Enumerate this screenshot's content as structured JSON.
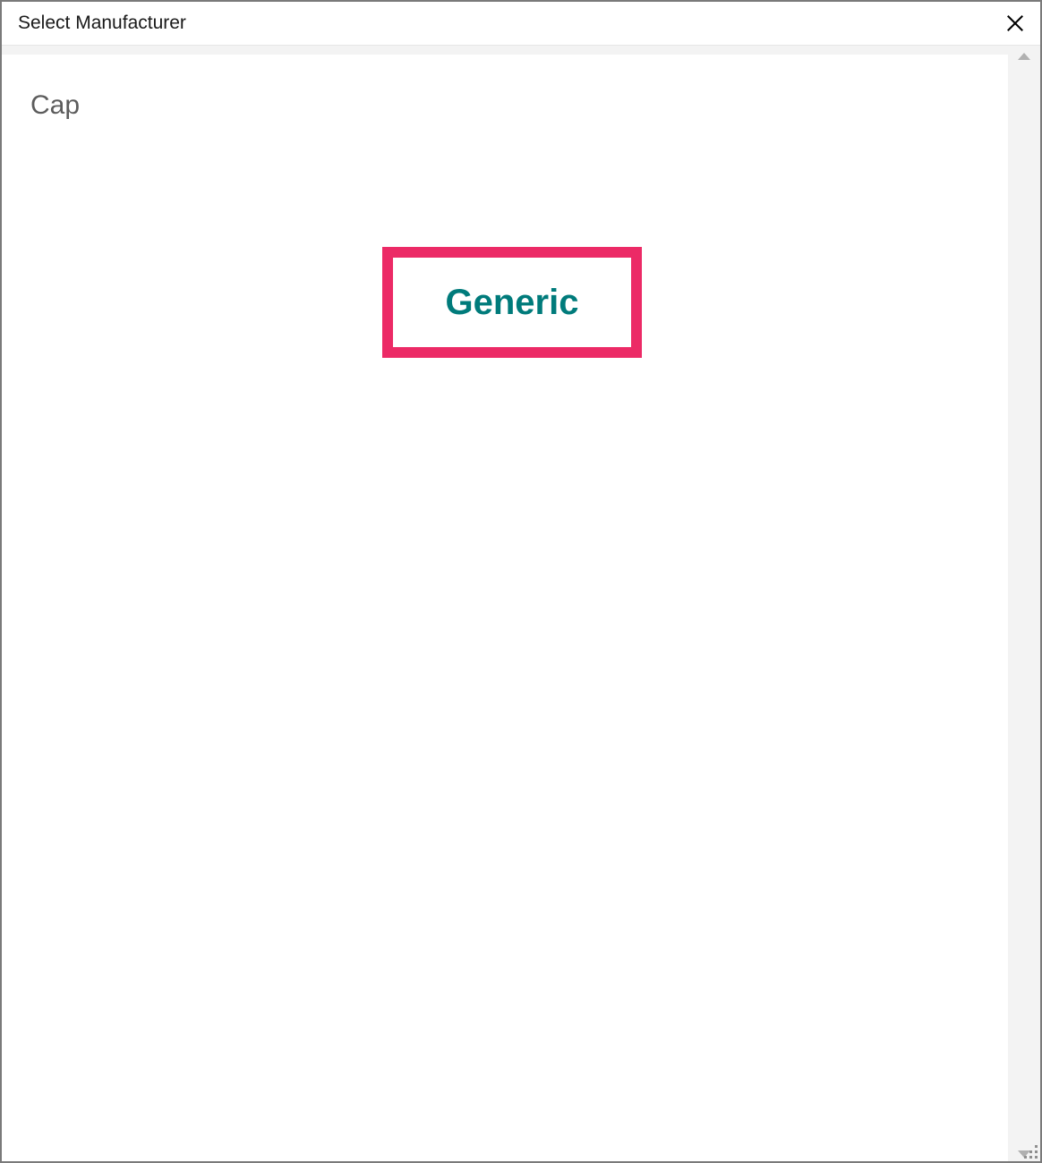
{
  "dialog": {
    "title": "Select Manufacturer"
  },
  "filter": {
    "label": "Cap"
  },
  "manufacturer": {
    "name": "Generic",
    "highlight_color": "#ec2a66",
    "text_color": "#007b7b"
  }
}
